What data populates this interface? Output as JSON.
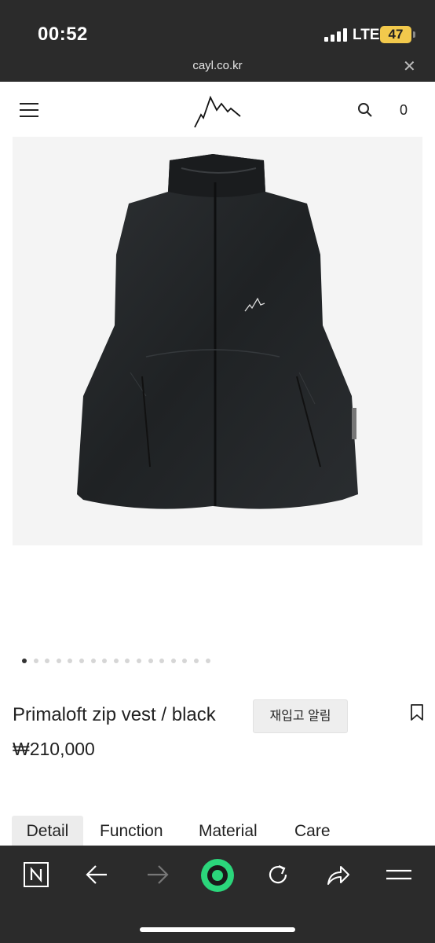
{
  "status": {
    "time": "00:52",
    "network": "LTE",
    "battery": "47"
  },
  "browser": {
    "url": "cayl.co.kr",
    "close_label": "✕"
  },
  "header": {
    "logo_icon": "mountain-logo-icon",
    "cart_count": "0"
  },
  "gallery": {
    "image": "black quilted zip vest product photo",
    "slide_count": 17,
    "active_slide": 0
  },
  "product": {
    "name": "Primaloft zip vest / black",
    "restock_label": "재입고 알림",
    "price": "₩210,000"
  },
  "tabs": [
    {
      "label": "Detail",
      "active": true
    },
    {
      "label": "Function",
      "active": false
    },
    {
      "label": "Material",
      "active": false
    },
    {
      "label": "Care",
      "active": false
    }
  ],
  "toolbar": {
    "icons": [
      "naver-icon",
      "back-icon",
      "forward-icon",
      "green-dot-icon",
      "reload-icon",
      "share-icon",
      "menu-icon"
    ]
  },
  "colors": {
    "status_bg": "#2b2b2b",
    "battery": "#f2c94c",
    "accent_green": "#2bd67b"
  }
}
